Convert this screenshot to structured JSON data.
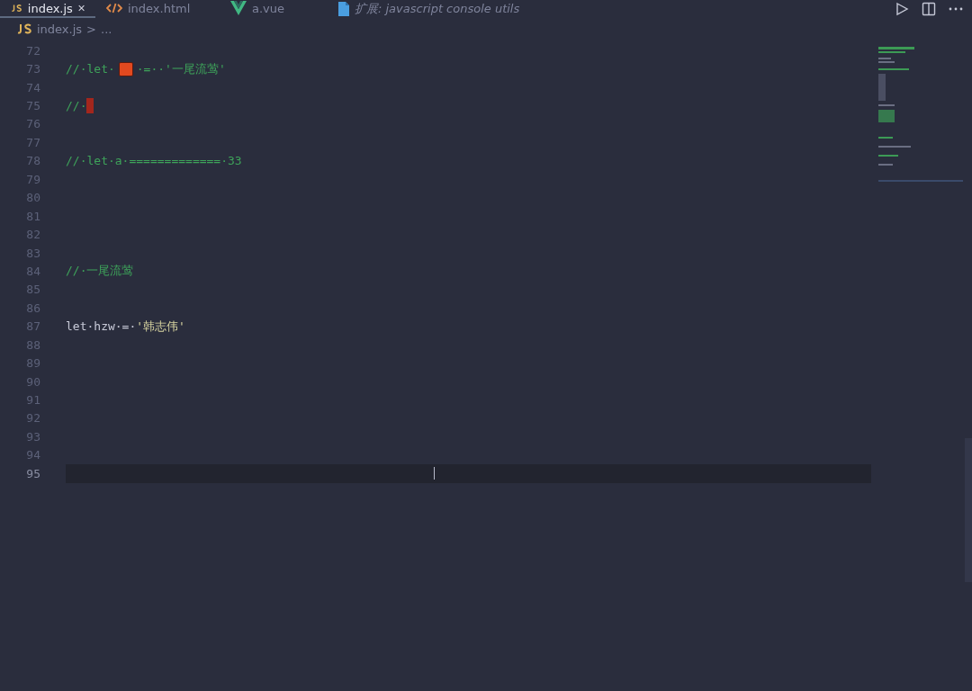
{
  "tabs": [
    {
      "label": "index.js",
      "selected": true,
      "preview": false
    },
    {
      "label": "index.html",
      "selected": false,
      "preview": false
    },
    {
      "label": "a.vue",
      "selected": false,
      "preview": false
    },
    {
      "label": "扩展: javascript console utils",
      "selected": false,
      "preview": true
    }
  ],
  "breadcrumb": {
    "file": "index.js",
    "separator": ">",
    "rest": "..."
  },
  "editor": {
    "lines": [
      {
        "number": "72",
        "current": false
      },
      {
        "number": "73",
        "current": false,
        "tokens": [
          {
            "kind": "comment",
            "text": "//·let·"
          },
          {
            "kind": "emoji"
          },
          {
            "kind": "comment",
            "text": "·=··'一尾流莺'"
          }
        ]
      },
      {
        "number": "74",
        "current": false
      },
      {
        "number": "75",
        "current": false,
        "tokens": [
          {
            "kind": "comment",
            "text": "//·"
          },
          {
            "kind": "invalid"
          }
        ]
      },
      {
        "number": "76",
        "current": false
      },
      {
        "number": "77",
        "current": false
      },
      {
        "number": "78",
        "current": false,
        "tokens": [
          {
            "kind": "comment",
            "text": "//·let·a·=============·33"
          }
        ]
      },
      {
        "number": "79",
        "current": false
      },
      {
        "number": "80",
        "current": false
      },
      {
        "number": "81",
        "current": false
      },
      {
        "number": "82",
        "current": false
      },
      {
        "number": "83",
        "current": false
      },
      {
        "number": "84",
        "current": false,
        "tokens": [
          {
            "kind": "comment",
            "text": "//·一尾流莺"
          }
        ]
      },
      {
        "number": "85",
        "current": false
      },
      {
        "number": "86",
        "current": false
      },
      {
        "number": "87",
        "current": false,
        "tokens": [
          {
            "kind": "plain",
            "text": "let·hzw·=·"
          },
          {
            "kind": "string",
            "text": "'韩志伟'"
          }
        ]
      },
      {
        "number": "88",
        "current": false
      },
      {
        "number": "89",
        "current": false
      },
      {
        "number": "90",
        "current": false
      },
      {
        "number": "91",
        "current": false
      },
      {
        "number": "92",
        "current": false
      },
      {
        "number": "93",
        "current": false
      },
      {
        "number": "94",
        "current": false
      },
      {
        "number": "95",
        "current": true
      }
    ]
  }
}
